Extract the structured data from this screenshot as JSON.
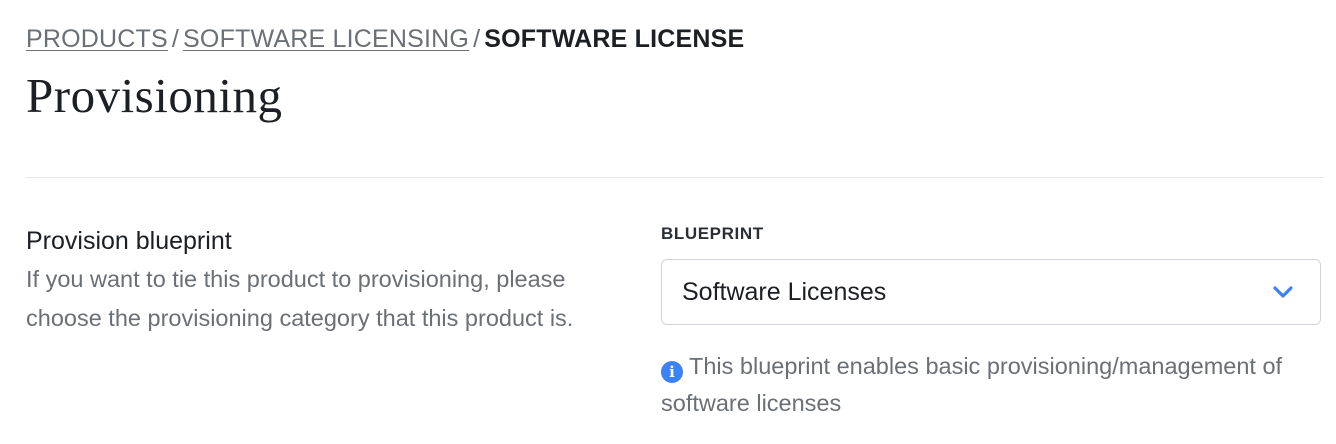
{
  "breadcrumb": {
    "items": [
      {
        "label": "PRODUCTS"
      },
      {
        "label": "SOFTWARE LICENSING"
      },
      {
        "label": "SOFTWARE LICENSE"
      }
    ],
    "separator": "/"
  },
  "page": {
    "title": "Provisioning"
  },
  "section": {
    "heading": "Provision blueprint",
    "description": "If you want to tie this product to provisioning, please choose the provisioning category that this product is."
  },
  "blueprint": {
    "label": "BLUEPRINT",
    "selected": "Software Licenses",
    "hint": "This blueprint enables basic provisioning/management of software licenses",
    "info_icon_glyph": "i"
  },
  "icons": {
    "chevron": "chevron-down-icon",
    "info": "info-icon"
  },
  "colors": {
    "accent": "#3b82f6",
    "muted_text": "#6b6f76",
    "divider": "#e5e7eb"
  }
}
